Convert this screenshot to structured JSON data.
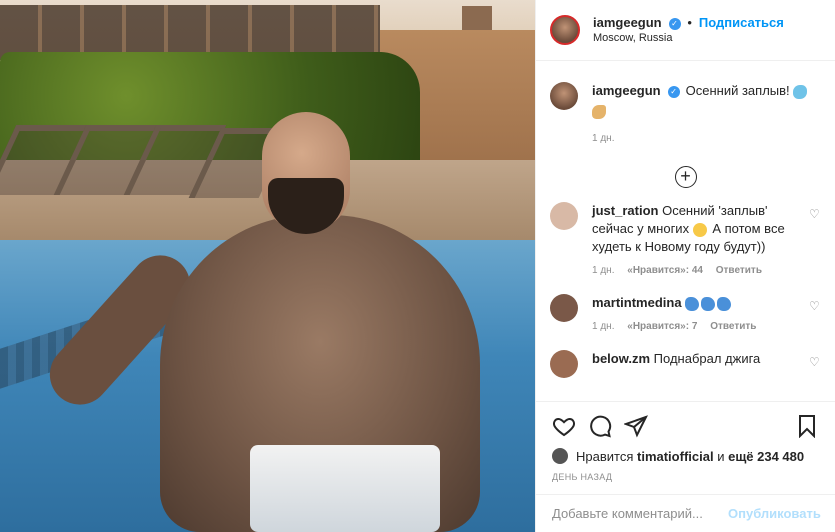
{
  "post": {
    "author": "iamgeegun",
    "follow_label": "Подписаться",
    "location": "Moscow, Russia"
  },
  "caption": {
    "author": "iamgeegun",
    "text": "Осенний заплыв!",
    "time": "1 дн."
  },
  "comments": [
    {
      "author": "just_ration",
      "text": "Осенний 'заплыв' сейчас у многих",
      "text2": "А потом все худеть к Новому году будут))",
      "time": "1 дн.",
      "likes": "«Нравится»: 44",
      "reply": "Ответить",
      "avatar_color": "#d8b9a6"
    },
    {
      "author": "martintmedina",
      "text": "",
      "time": "1 дн.",
      "likes": "«Нравится»: 7",
      "reply": "Ответить",
      "avatar_color": "#7a5848"
    },
    {
      "author": "below.zm",
      "text": "Поднабрал джига",
      "avatar_color": "#9a6b52"
    }
  ],
  "likes_line": {
    "prefix": "Нравится",
    "user": "timatiofficial",
    "middle": "и",
    "others": "ещё 234 480"
  },
  "time_ago": "ДЕНЬ НАЗАД",
  "comment_box": {
    "placeholder": "Добавьте комментарий...",
    "publish_label": "Опубликовать"
  },
  "colors": {
    "accent": "#0095f6",
    "verified": "#3897f0",
    "muted": "#8e8e8e",
    "publish_disabled": "#b2dffc"
  },
  "icons": [
    "verified-icon",
    "dolphin-emoji",
    "muscle-emoji",
    "plus-circle-icon",
    "heart-icon",
    "comment-icon",
    "share-icon",
    "bookmark-icon"
  ]
}
